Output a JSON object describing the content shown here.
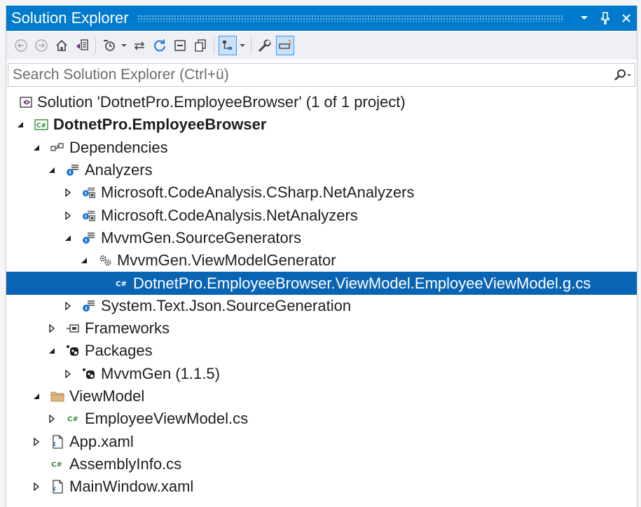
{
  "window": {
    "title": "Solution Explorer"
  },
  "search": {
    "placeholder": "Search Solution Explorer (Ctrl+ü)"
  },
  "tree": {
    "solution": "Solution 'DotnetPro.EmployeeBrowser' (1 of 1 project)",
    "project": "DotnetPro.EmployeeBrowser",
    "dependencies": "Dependencies",
    "analyzers": "Analyzers",
    "analyzer_csharp": "Microsoft.CodeAnalysis.CSharp.NetAnalyzers",
    "analyzer_net": "Microsoft.CodeAnalysis.NetAnalyzers",
    "mvvmgen_generators": "MvvmGen.SourceGenerators",
    "viewmodel_generator": "MvvmGen.ViewModelGenerator",
    "generated_file": "DotnetPro.EmployeeBrowser.ViewModel.EmployeeViewModel.g.cs",
    "system_text_json": "System.Text.Json.SourceGeneration",
    "frameworks": "Frameworks",
    "packages": "Packages",
    "mvvmgen_package": "MvvmGen (1.1.5)",
    "viewmodel_folder": "ViewModel",
    "employee_viewmodel": "EmployeeViewModel.cs",
    "app_xaml": "App.xaml",
    "assembly_info": "AssemblyInfo.cs",
    "main_window": "MainWindow.xaml"
  },
  "colors": {
    "titlebar": "#007acc",
    "selection": "#0a64b4",
    "csharp_icon": "#388a34",
    "folder": "#dcb67a"
  }
}
